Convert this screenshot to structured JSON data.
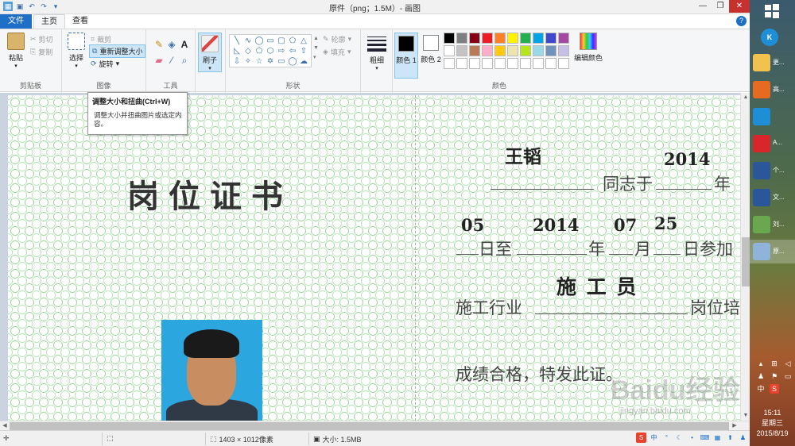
{
  "window": {
    "title": "原件（png；1.5M）- 画图",
    "min_icon": "minimize-icon",
    "max_icon": "restore-icon",
    "close_icon": "close-icon"
  },
  "tabs": {
    "file": "文件",
    "home": "主页",
    "view": "查看"
  },
  "ribbon": {
    "clipboard": {
      "paste": "粘贴",
      "cut": "剪切",
      "copy": "复制",
      "label": "剪贴板"
    },
    "image": {
      "select": "选择",
      "crop": "裁剪",
      "resize": "重新调整大小",
      "rotate": "旋转",
      "label": "图像"
    },
    "tools": {
      "label": "工具"
    },
    "brushes": {
      "label": "刷子"
    },
    "shapes": {
      "outline": "轮廓",
      "fill": "填充",
      "label": "形状"
    },
    "size": {
      "label": "粗细"
    },
    "colors": {
      "color1": "颜色 1",
      "color2": "颜色 2",
      "edit": "编辑颜色",
      "label": "颜色",
      "color1_value": "#000000",
      "color2_value": "#ffffff",
      "palette": [
        "#000000",
        "#7f7f7f",
        "#880015",
        "#ed1c24",
        "#ff7f27",
        "#fff200",
        "#22b14c",
        "#00a2e8",
        "#3f48cc",
        "#a349a4",
        "#ffffff",
        "#c3c3c3",
        "#b97a57",
        "#ffaec9",
        "#ffc90e",
        "#efe4b0",
        "#b5e61d",
        "#99d9ea",
        "#7092be",
        "#c8bfe7",
        "#ffffff",
        "#ffffff",
        "#ffffff",
        "#ffffff",
        "#ffffff",
        "#ffffff",
        "#ffffff",
        "#ffffff",
        "#ffffff",
        "#ffffff"
      ]
    }
  },
  "tooltip": {
    "title": "调整大小和扭曲(Ctrl+W)",
    "body": "调整大小并扭曲图片或选定内容。"
  },
  "certificate": {
    "title": "岗位证书",
    "name": "王韬",
    "year1": "2014",
    "tongzhi": "同志于",
    "nian": "年",
    "month1": "05",
    "year2": "2014",
    "month2": "07",
    "day2": "25",
    "ri_zhi": "日至",
    "nian2": "年",
    "yue": "月",
    "ri_canjia": "日参加",
    "role": "施 工 员",
    "industry": "施工行业",
    "gangwei": "岗位培",
    "result": "成绩合格，特发此证。",
    "watermark": "Baidu经验",
    "watermark_url": "jingyan.baidu.com"
  },
  "status": {
    "dimensions": "1403 × 1012像素",
    "size": "大小: 1.5MB"
  },
  "taskbar": {
    "items": [
      {
        "label": "更...",
        "color": "#f2c14e"
      },
      {
        "label": "高...",
        "color": "#e66a1f"
      },
      {
        "label": "",
        "color": "#1e8fd6"
      },
      {
        "label": "A...",
        "color": "#d9262b"
      },
      {
        "label": "个...",
        "color": "#2b579a"
      },
      {
        "label": "文...",
        "color": "#2b579a"
      },
      {
        "label": "刘...",
        "color": "#6aa84f"
      },
      {
        "label": "原...",
        "color": "#8fb3d9"
      }
    ],
    "ime": "中",
    "time": "15:11",
    "weekday": "星期三",
    "date": "2015/8/19"
  }
}
